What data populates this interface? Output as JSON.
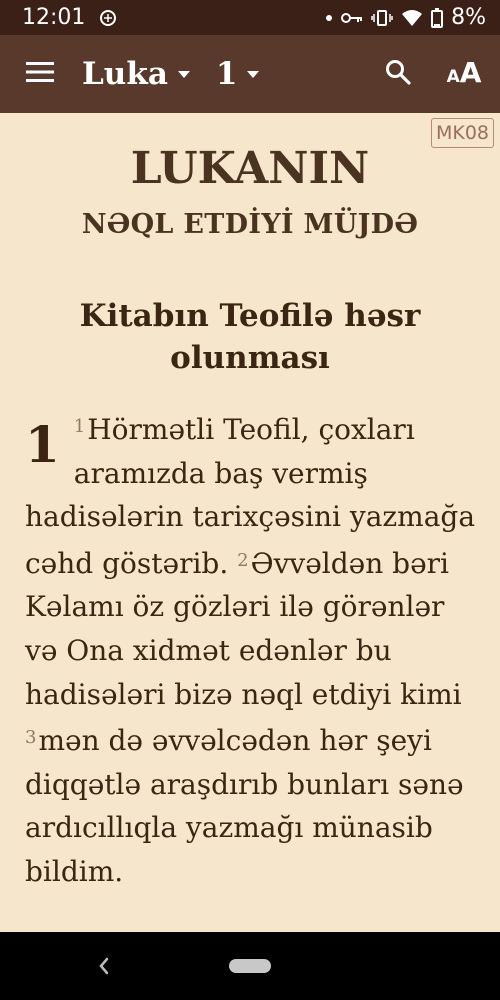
{
  "status_bar": {
    "time": "12:01",
    "battery": "8%",
    "icons": [
      "debug-icon",
      "dot-icon",
      "vpn-key-icon",
      "vibrate-icon",
      "wifi-icon",
      "battery-icon"
    ]
  },
  "app_bar": {
    "book": "Luka",
    "chapter": "1",
    "font_size_label_small": "A",
    "font_size_label_big": "A"
  },
  "reader": {
    "version_badge": "MK08",
    "book_title_main": "LUKANIN",
    "book_title_sub": "NƏQL ETDİYİ MÜJDƏ",
    "section_heading": "Kitabın Teofilə həsr olunması",
    "chapter_number": "1",
    "verses": [
      {
        "number": "1",
        "text": "Hörmətli Teofil, çoxları aramızda baş vermiş hadisələrin tarixçəsini yazmağa cəhd göstərib."
      },
      {
        "number": "2",
        "text": "Əvvəldən bəri Kəlamı öz gözləri ilə görənlər və Ona xidmət edənlər bu hadisələri bizə nəql etdiyi kimi"
      },
      {
        "number": "3",
        "text": "mən də əvvəlcədən hər şeyi diqqətlə araşdırıb bunları sənə ardıcıllıqla yazmağı münasib bildim."
      }
    ]
  },
  "colors": {
    "status_bar_bg": "#3b2017",
    "app_bar_bg": "#58392c",
    "page_bg": "#f5e6cc",
    "text": "#3a2613"
  }
}
